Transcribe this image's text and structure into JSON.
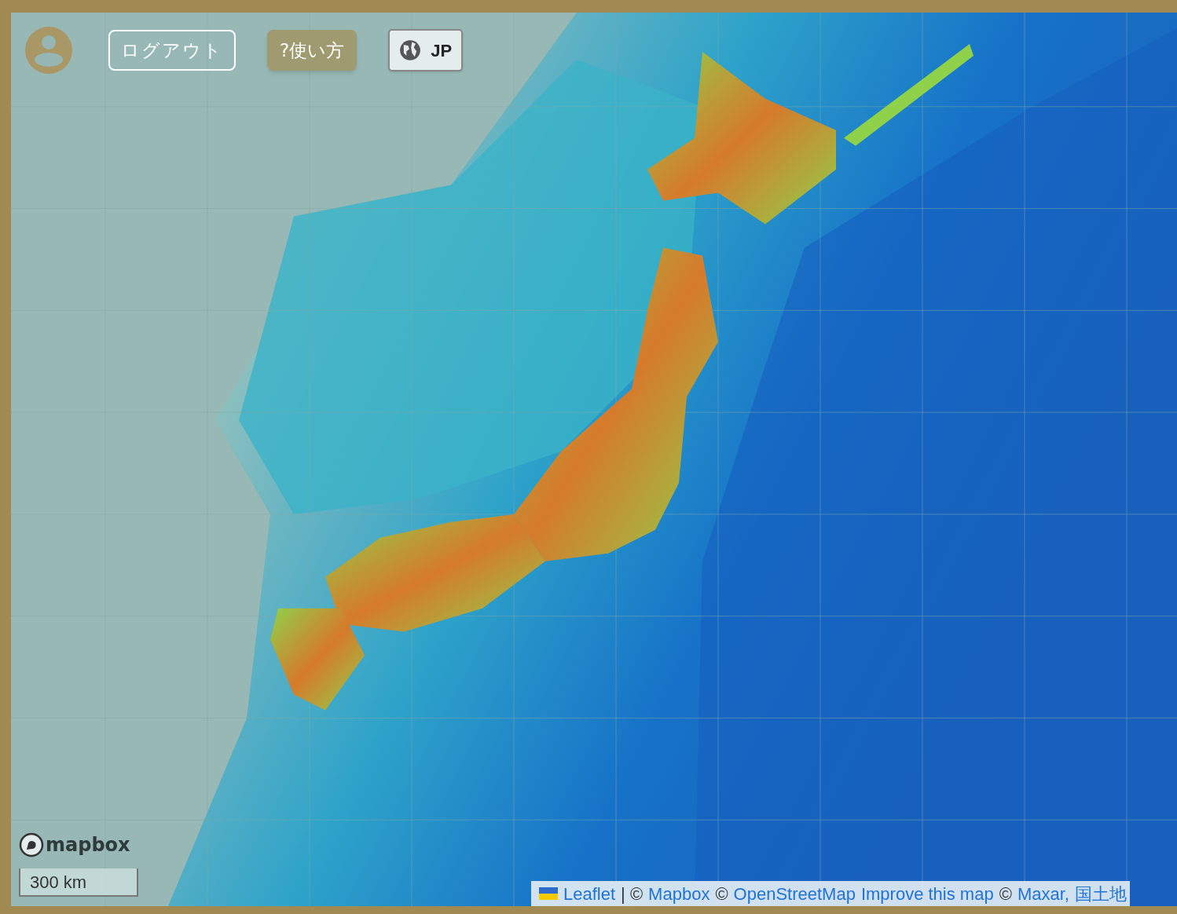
{
  "toolbar": {
    "logout": "ログアウト",
    "help": "?使い方",
    "language": "JP"
  },
  "map": {
    "logo": "mapbox",
    "scale": "300 km",
    "attribution": [
      {
        "kind": "link",
        "text": "Leaflet"
      },
      {
        "kind": "text",
        "text": "| ©"
      },
      {
        "kind": "link",
        "text": "Mapbox"
      },
      {
        "kind": "text",
        "text": "©"
      },
      {
        "kind": "link",
        "text": "OpenStreetMap"
      },
      {
        "kind": "link",
        "text": "Improve this map"
      },
      {
        "kind": "text",
        "text": "©"
      },
      {
        "kind": "link",
        "text": "Maxar,"
      },
      {
        "kind": "link",
        "text": "国土地"
      }
    ]
  }
}
